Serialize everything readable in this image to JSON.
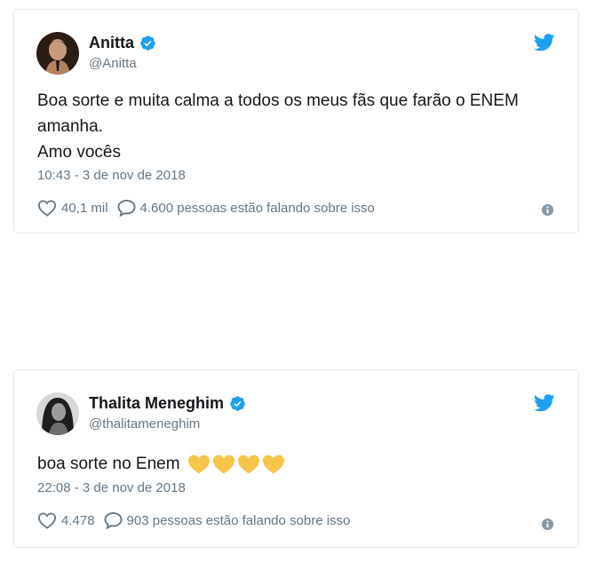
{
  "colors": {
    "twitter_blue": "#1da1f2",
    "text_primary": "#14171a",
    "text_secondary": "#657786",
    "card_border": "#e1e8ed",
    "heart_yellow": "#f7c54b"
  },
  "tweets": [
    {
      "user": {
        "name": "Anitta",
        "handle": "@Anitta",
        "verified": true
      },
      "text_lines": [
        "Boa sorte e muita calma a todos os meus fãs que farão o ENEM amanha.",
        "Amo vocês"
      ],
      "emoji": [],
      "timestamp": "10:43 - 3 de nov de 2018",
      "likes": "40,1 mil",
      "replies": "4.600 pessoas estão falando sobre isso",
      "icons": [
        "verified-badge-icon",
        "twitter-bird-icon",
        "heart-outline-icon",
        "speech-bubble-icon",
        "info-icon"
      ]
    },
    {
      "user": {
        "name": "Thalita Meneghim",
        "handle": "@thalitameneghim",
        "verified": true
      },
      "text_lines": [
        "boa sorte no Enem"
      ],
      "emoji": [
        "yellow-heart",
        "yellow-heart",
        "yellow-heart",
        "yellow-heart"
      ],
      "timestamp": "22:08 - 3 de nov de 2018",
      "likes": "4.478",
      "replies": "903 pessoas estão falando sobre isso",
      "icons": [
        "verified-badge-icon",
        "twitter-bird-icon",
        "heart-outline-icon",
        "speech-bubble-icon",
        "info-icon"
      ]
    }
  ]
}
